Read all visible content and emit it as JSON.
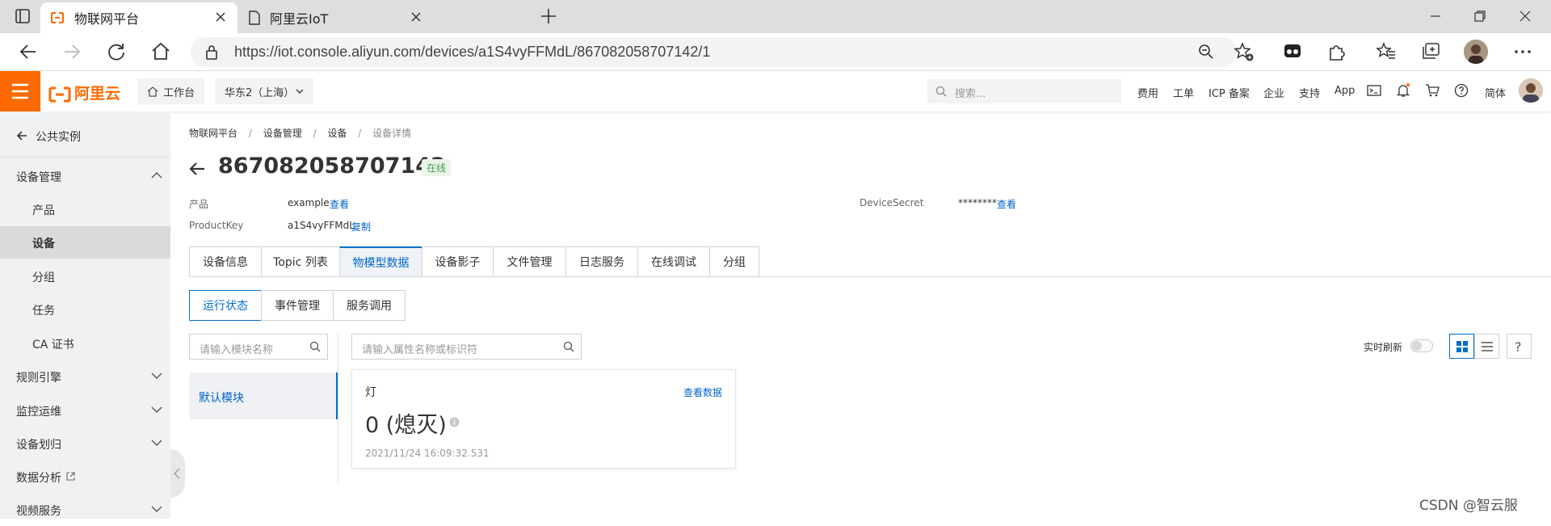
{
  "browser": {
    "tabs": [
      {
        "title": "物联网平台",
        "active": true
      },
      {
        "title": "阿里云IoT",
        "active": false
      }
    ],
    "url": "https://iot.console.aliyun.com/devices/a1S4vyFFMdL/867082058707142/1"
  },
  "console_header": {
    "logo": "阿里云",
    "workbench": "工作台",
    "region": "华东2（上海）",
    "search_placeholder": "搜索...",
    "links": [
      "费用",
      "工单",
      "ICP 备案",
      "企业",
      "支持",
      "App"
    ],
    "lang": "简体",
    "accent_color": "#ff6a00"
  },
  "sidebar": {
    "back": "公共实例",
    "items": [
      {
        "label": "设备管理",
        "type": "group",
        "expanded": true
      },
      {
        "label": "产品",
        "type": "child"
      },
      {
        "label": "设备",
        "type": "child",
        "selected": true
      },
      {
        "label": "分组",
        "type": "child"
      },
      {
        "label": "任务",
        "type": "child"
      },
      {
        "label": "CA 证书",
        "type": "child"
      },
      {
        "label": "规则引擎",
        "type": "group",
        "expanded": false
      },
      {
        "label": "监控运维",
        "type": "group",
        "expanded": false
      },
      {
        "label": "设备划归",
        "type": "group",
        "expanded": false
      },
      {
        "label": "数据分析",
        "type": "external"
      },
      {
        "label": "视频服务",
        "type": "group",
        "expanded": false
      }
    ]
  },
  "breadcrumb": [
    "物联网平台",
    "设备管理",
    "设备",
    "设备详情"
  ],
  "device": {
    "name": "867082058707142",
    "status": "在线",
    "product_label": "产品",
    "product_value": "example",
    "product_action": "查看",
    "productkey_label": "ProductKey",
    "productkey_value": "a1S4vyFFMdL",
    "productkey_action": "复制",
    "secret_label": "DeviceSecret",
    "secret_value": "********",
    "secret_action": "查看"
  },
  "detail_tabs": [
    "设备信息",
    "Topic 列表",
    "物模型数据",
    "设备影子",
    "文件管理",
    "日志服务",
    "在线调试",
    "分组"
  ],
  "detail_tab_selected": 2,
  "sub_tabs": [
    "运行状态",
    "事件管理",
    "服务调用"
  ],
  "sub_tab_selected": 0,
  "module_search_placeholder": "请输入模块名称",
  "property_search_placeholder": "请输入属性名称或标识符",
  "realtime_refresh_label": "实时刷新",
  "modules": [
    "默认模块"
  ],
  "property_card": {
    "name": "灯",
    "action": "查看数据",
    "value": "0 (熄灭)",
    "timestamp": "2021/11/24 16:09:32.531"
  },
  "watermark": "CSDN @智云服"
}
